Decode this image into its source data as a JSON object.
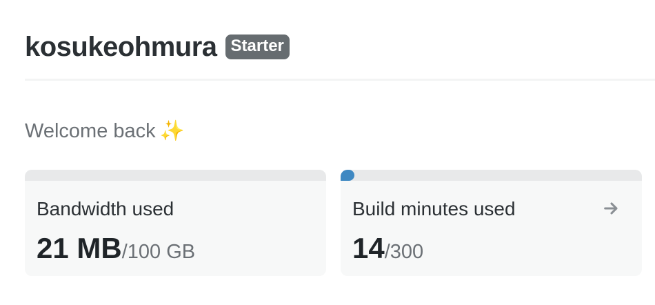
{
  "header": {
    "team_name": "kosukeohmura",
    "plan_badge": "Starter"
  },
  "welcome": {
    "text": "Welcome back",
    "emoji": "✨"
  },
  "cards": [
    {
      "label": "Bandwidth used",
      "used": "21 MB",
      "limit": "/100 GB",
      "progress_fraction": 0.0002
    },
    {
      "label": "Build minutes used",
      "used": "14",
      "limit": "/300",
      "progress_fraction": 0.0467,
      "icon": "arrow-right-icon"
    }
  ]
}
